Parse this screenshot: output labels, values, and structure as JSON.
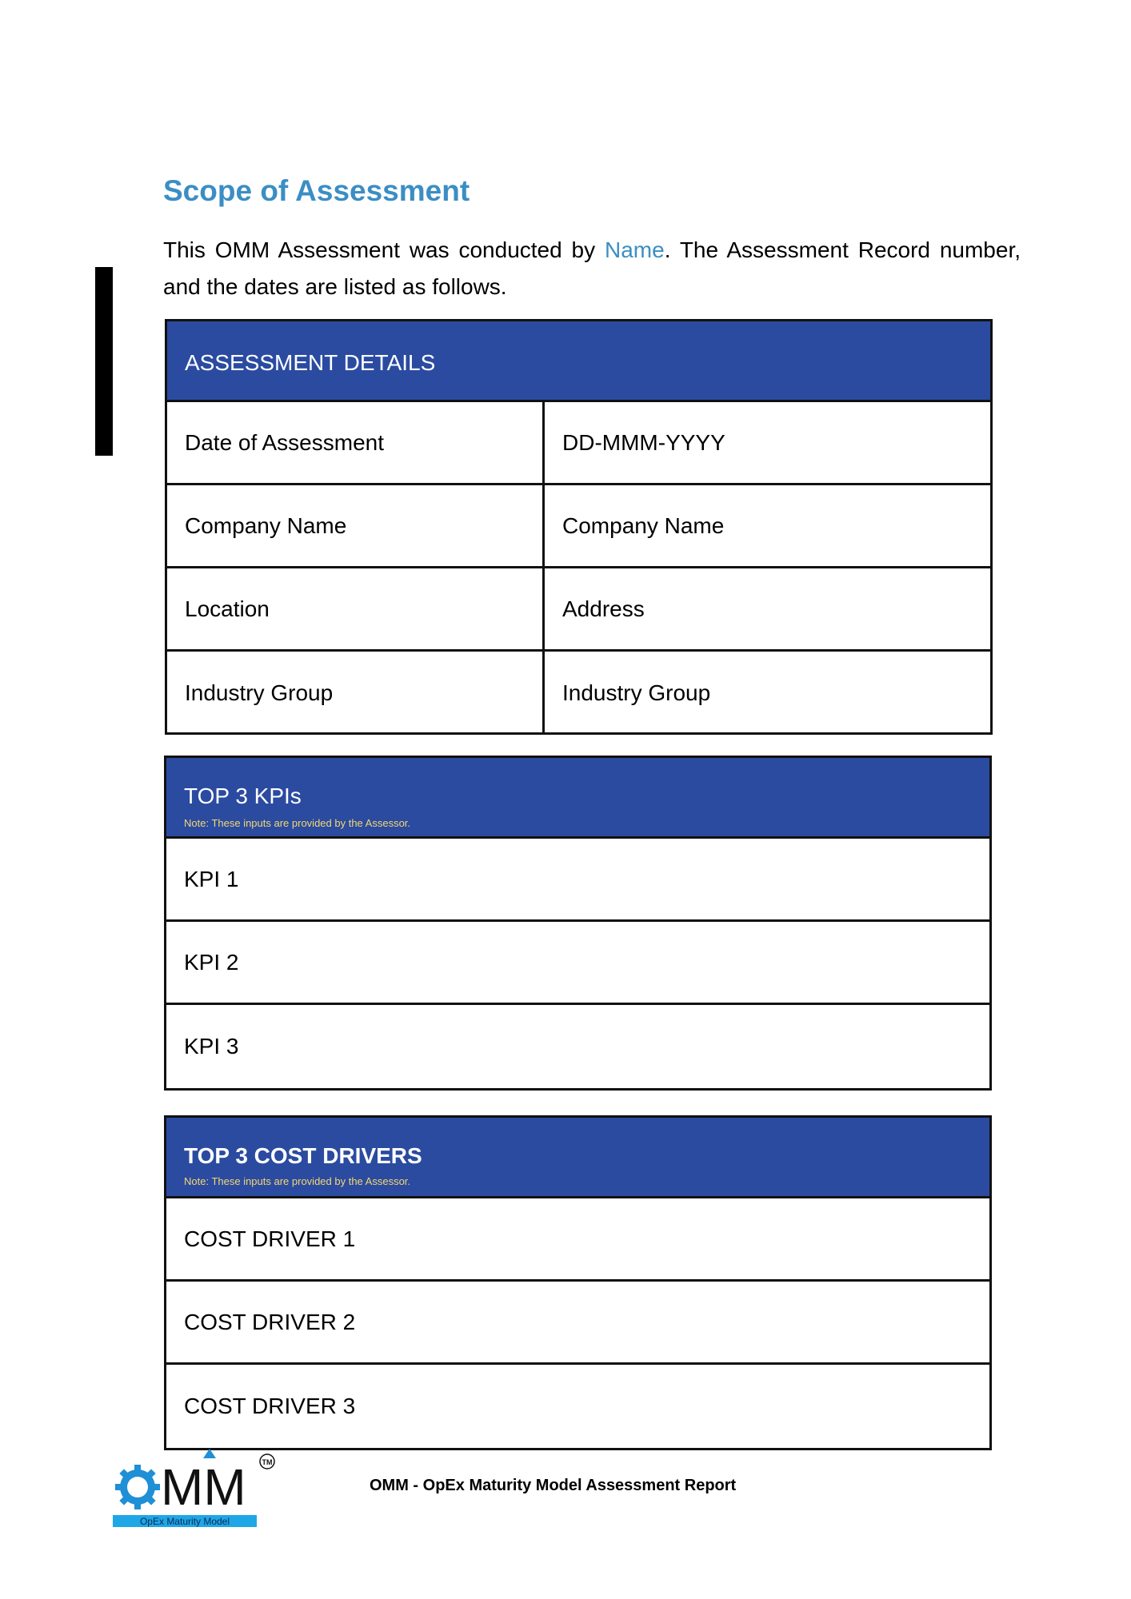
{
  "section": {
    "title": "Scope of Assessment",
    "intro_before": "This OMM Assessment was conducted by ",
    "intro_name": "Name",
    "intro_after": ". The Assessment Record number, and the dates are listed as follows."
  },
  "assessment_details": {
    "header": "ASSESSMENT DETAILS",
    "rows": [
      {
        "label": "Date of Assessment",
        "value": "DD-MMM-YYYY"
      },
      {
        "label": "Company Name",
        "value": "Company Name"
      },
      {
        "label": "Location",
        "value": "Address"
      },
      {
        "label": "Industry Group",
        "value": "Industry Group"
      }
    ]
  },
  "kpis": {
    "header": "TOP 3 KPIs",
    "note": "Note: These inputs are provided by the Assessor.",
    "rows": [
      "KPI 1",
      "KPI 2",
      "KPI 3"
    ]
  },
  "cost_drivers": {
    "header": "TOP 3 COST DRIVERS",
    "note": "Note: These inputs are provided by the Assessor.",
    "rows": [
      "COST DRIVER 1",
      "COST DRIVER 2",
      "COST DRIVER 3"
    ]
  },
  "footer": {
    "logo_text": "MM",
    "logo_tagline": "OpEx Maturity Model",
    "logo_tm": "TM",
    "title": "OMM - OpEx Maturity Model Assessment Report"
  },
  "colors": {
    "heading": "#3b8ec4",
    "table_header": "#2b4ba1",
    "note": "#f5d76e"
  }
}
